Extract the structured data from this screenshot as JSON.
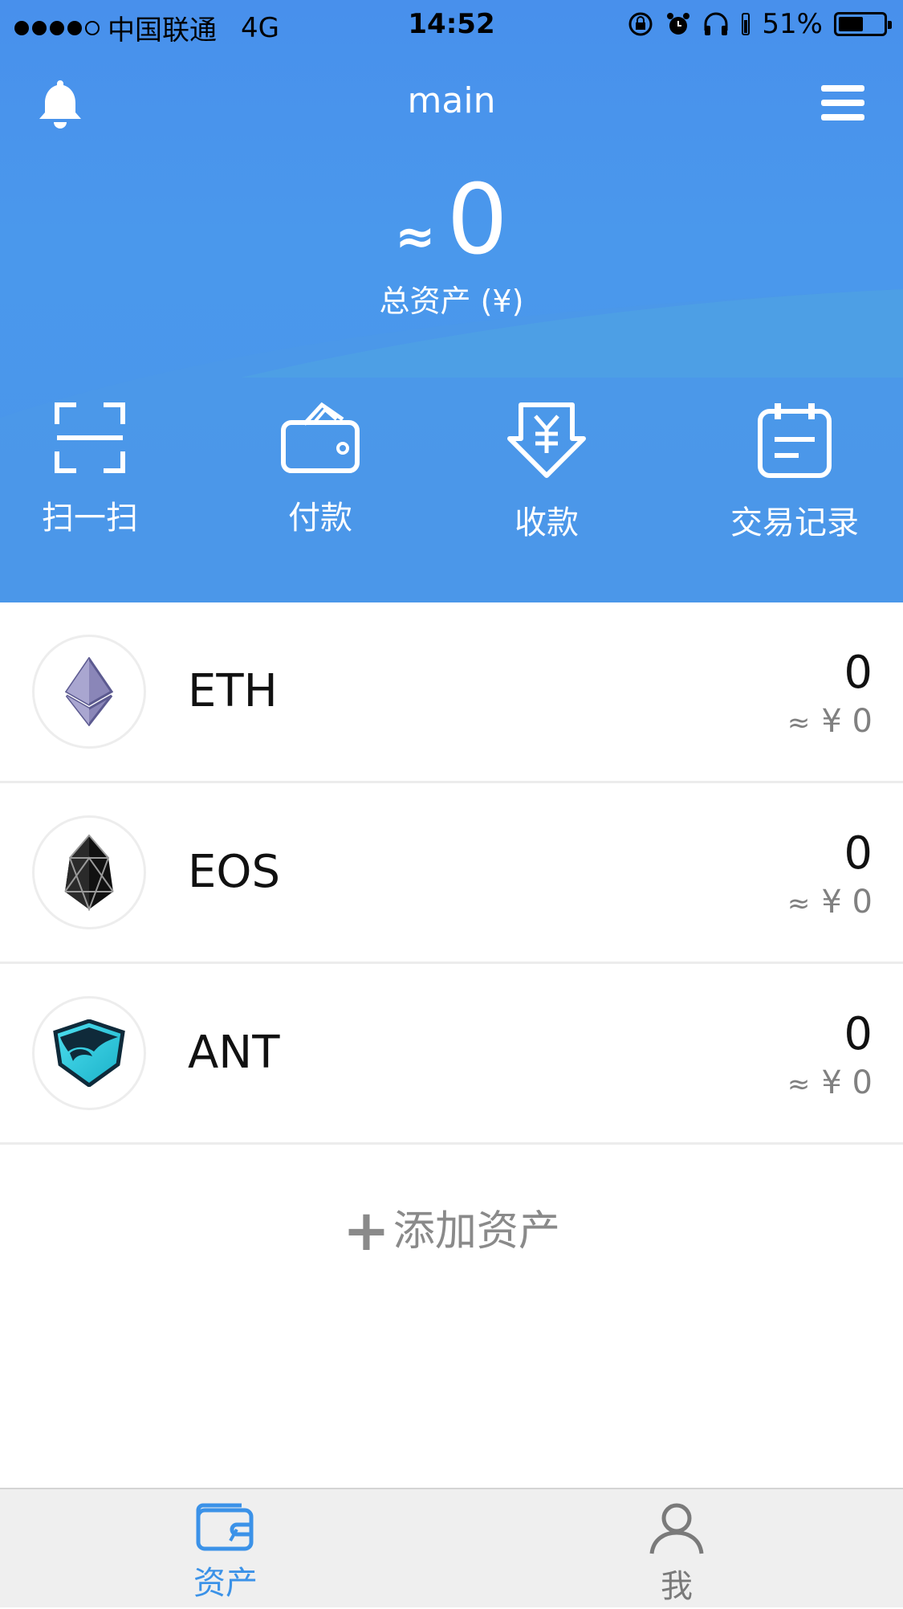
{
  "status_bar": {
    "carrier": "中国联通",
    "network": "4G",
    "time": "14:52",
    "battery": "51%"
  },
  "header": {
    "title": "main",
    "total_approx": "≈",
    "total_value": "0",
    "total_label": "总资产 (¥)"
  },
  "actions": [
    {
      "label": "扫一扫",
      "icon": "scan-icon"
    },
    {
      "label": "付款",
      "icon": "wallet-icon"
    },
    {
      "label": "收款",
      "icon": "receive-icon"
    },
    {
      "label": "交易记录",
      "icon": "records-icon"
    }
  ],
  "assets": [
    {
      "name": "ETH",
      "amount": "0",
      "fiat_approx": "≈",
      "fiat": "¥ 0",
      "icon": "eth-logo"
    },
    {
      "name": "EOS",
      "amount": "0",
      "fiat_approx": "≈",
      "fiat": "¥ 0",
      "icon": "eos-logo"
    },
    {
      "name": "ANT",
      "amount": "0",
      "fiat_approx": "≈",
      "fiat": "¥ 0",
      "icon": "ant-logo"
    }
  ],
  "add_asset": {
    "plus": "+",
    "label": "添加资产"
  },
  "tabs": [
    {
      "label": "资产",
      "icon": "wallet-tab-icon",
      "active": true
    },
    {
      "label": "我",
      "icon": "user-icon",
      "active": false
    }
  ],
  "colors": {
    "header_blue": "#4a94ec",
    "tab_active": "#3b92e8",
    "tab_inactive": "#7a7a7a"
  }
}
